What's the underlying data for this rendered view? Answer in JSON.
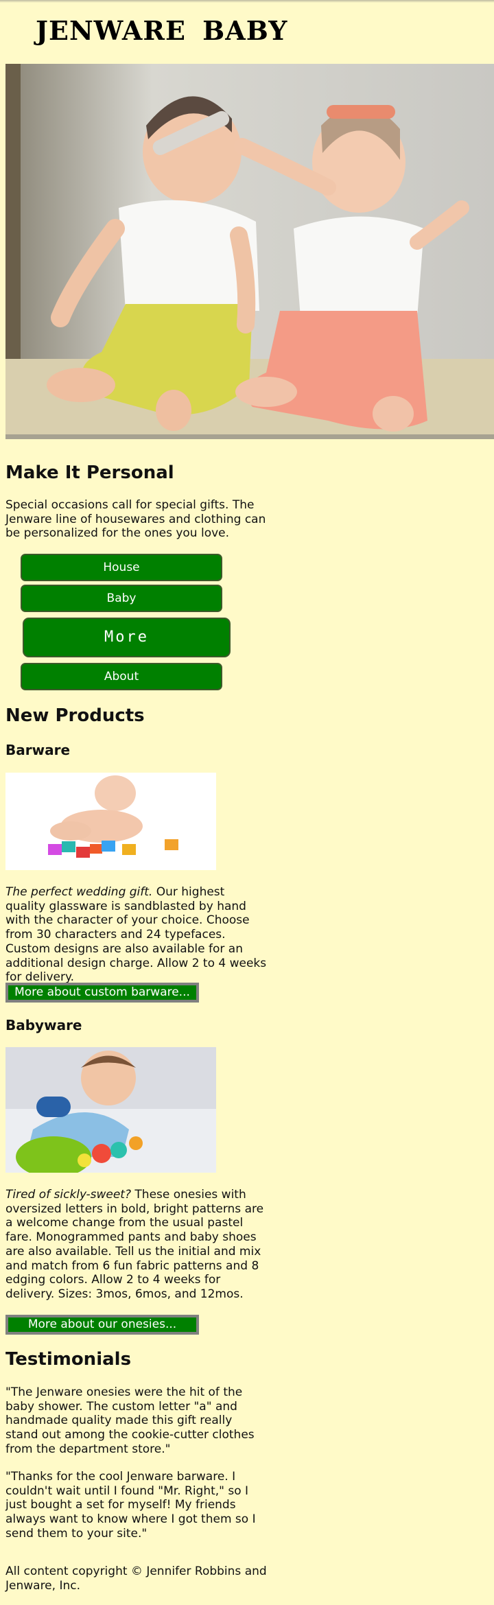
{
  "site": {
    "title": "JENWARE  BABY"
  },
  "intro": {
    "heading": "Make It Personal",
    "text": "Special occasions call for special gifts. The Jenware line of housewares and clothing can be personalized for the ones you love."
  },
  "nav": {
    "house": "House",
    "baby": "Baby",
    "more": "More",
    "about": "About"
  },
  "products": {
    "heading": "New Products",
    "barware": {
      "title": "Barware",
      "lead": "The perfect wedding gift.",
      "text": " Our highest quality glassware is sandblasted by hand with the character of your choice. Choose from 30 characters and 24 typefaces. Custom designs are also available for an additional design charge. Allow 2 to 4 weeks for delivery.",
      "cta": "More about custom barware..."
    },
    "babyware": {
      "title": "Babyware",
      "lead": "Tired of sickly-sweet?",
      "text": " These onesies with oversized letters in bold, bright patterns are a welcome change from the usual pastel fare. Monogrammed pants and baby shoes are also available. Tell us the initial and mix and match from 6 fun fabric patterns and 8 edging colors. Allow 2 to 4 weeks for delivery. Sizes: 3mos, 6mos, and 12mos.",
      "cta": "More about our onesies..."
    }
  },
  "testimonials": {
    "heading": "Testimonials",
    "items": [
      "\"The Jenware onesies were the hit of the baby shower. The custom letter \"a\" and handmade quality made this gift really stand out among the cookie-cutter clothes from the department store.\"",
      "\"Thanks for the cool Jenware barware. I couldn't wait until I found \"Mr. Right,\" so I just bought a set for myself! My friends always want to know where I got them so I send them to your site.\""
    ]
  },
  "footer": {
    "copyright": "All content copyright © Jennifer Robbins and Jenware, Inc."
  },
  "colors": {
    "page_background": "#fffac8",
    "button_green": "#008000",
    "cta_border": "#808080"
  }
}
